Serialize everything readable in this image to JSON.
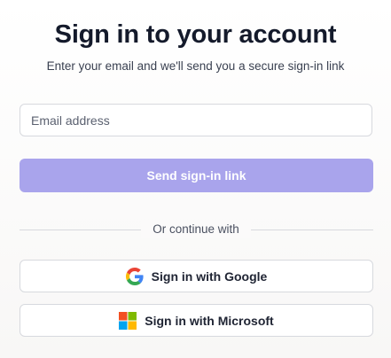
{
  "title": "Sign in to your account",
  "subtitle": "Enter your email and we'll send you a secure sign-in link",
  "email_field": {
    "placeholder": "Email address",
    "value": ""
  },
  "primary_button": {
    "label": "Send sign-in link",
    "color": "#a9a4ec"
  },
  "divider": {
    "label": "Or continue with"
  },
  "social_buttons": [
    {
      "label": "Sign in with Google",
      "icon": "google-icon"
    },
    {
      "label": "Sign in with Microsoft",
      "icon": "microsoft-icon"
    }
  ]
}
